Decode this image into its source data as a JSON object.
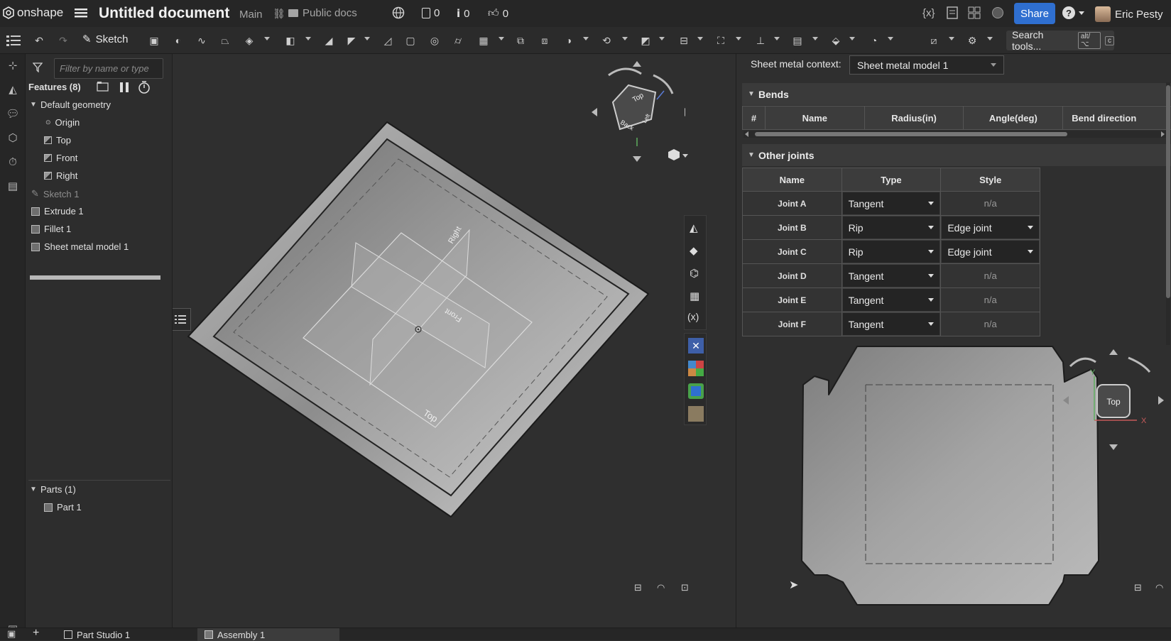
{
  "app": {
    "logo_text": "onshape",
    "document_title": "Untitled document",
    "workspace": "Main",
    "folder": "Public docs",
    "counters": [
      {
        "icon": "versions-icon",
        "value": "0"
      },
      {
        "icon": "info-icon",
        "value": "0"
      },
      {
        "icon": "like-icon",
        "value": "0"
      }
    ],
    "share_label": "Share",
    "help_symbol": "?",
    "user_name": "Eric Pesty"
  },
  "toolbar": {
    "sketch_label": "Sketch",
    "search_label": "Search tools...",
    "search_shortcut_1": "alt/⌥",
    "search_shortcut_2": "c"
  },
  "feature_panel": {
    "filter_placeholder": "Filter by name or type",
    "features_header": "Features (8)",
    "default_geometry": "Default geometry",
    "items": [
      {
        "label": "Origin"
      },
      {
        "label": "Top"
      },
      {
        "label": "Front"
      },
      {
        "label": "Right"
      },
      {
        "label": "Sketch 1"
      },
      {
        "label": "Extrude 1"
      },
      {
        "label": "Fillet 1"
      },
      {
        "label": "Sheet metal model 1"
      }
    ],
    "parts_header": "Parts (1)",
    "parts": [
      {
        "label": "Part 1"
      }
    ]
  },
  "viewport": {
    "plane_labels": [
      "Top",
      "Front",
      "Right"
    ],
    "view_cube_faces": [
      "Top",
      "Back",
      "Left"
    ]
  },
  "sheet_metal": {
    "context_label": "Sheet metal context:",
    "context_value": "Sheet metal model 1",
    "bends_header": "Bends",
    "bends_columns": [
      "#",
      "Name",
      "Radius(in)",
      "Angle(deg)",
      "Bend direction"
    ],
    "joints_header": "Other joints",
    "joints_columns": [
      "Name",
      "Type",
      "Style"
    ],
    "joints": [
      {
        "name": "Joint A",
        "type": "Tangent",
        "style": "n/a"
      },
      {
        "name": "Joint B",
        "type": "Rip",
        "style": "Edge joint"
      },
      {
        "name": "Joint C",
        "type": "Rip",
        "style": "Edge joint"
      },
      {
        "name": "Joint D",
        "type": "Tangent",
        "style": "n/a"
      },
      {
        "name": "Joint E",
        "type": "Tangent",
        "style": "n/a"
      },
      {
        "name": "Joint F",
        "type": "Tangent",
        "style": "n/a"
      }
    ],
    "flat_view_cube": "Top",
    "axis_y": "Y",
    "axis_x": "X"
  },
  "tabs": [
    {
      "label": "Part Studio 1"
    },
    {
      "label": "Assembly 1"
    }
  ],
  "colors": {
    "share_blue": "#2f6fd0",
    "background": "#2e2e2e"
  }
}
